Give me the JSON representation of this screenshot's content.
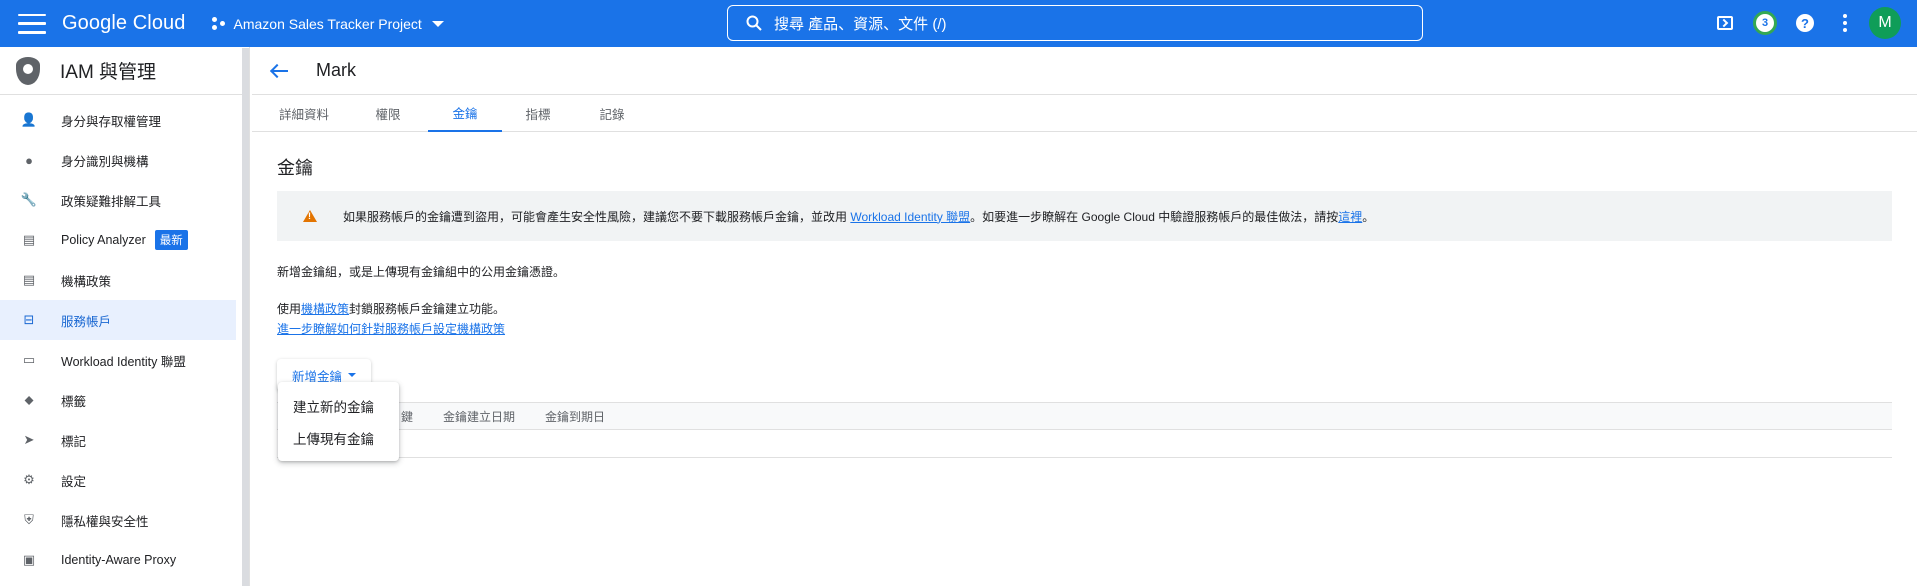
{
  "topbar": {
    "brand": "Google Cloud",
    "project": "Amazon Sales Tracker Project",
    "search_placeholder": "搜尋  產品、資源、文件 (/)",
    "notification_count": "3",
    "help": "?",
    "avatar_initial": "M",
    "colors": {
      "bar": "#1a73e8",
      "avatar": "#0f9d58"
    }
  },
  "sidebar": {
    "title": "IAM 與管理",
    "items": [
      {
        "label": "身分與存取權管理",
        "icon": "person-add-icon"
      },
      {
        "label": "身分識別與機構",
        "icon": "account-circle-icon"
      },
      {
        "label": "政策疑難排解工具",
        "icon": "wrench-icon"
      },
      {
        "label": "Policy Analyzer",
        "icon": "policy-analyzer-icon",
        "badge": "最新"
      },
      {
        "label": "機構政策",
        "icon": "list-alt-icon"
      },
      {
        "label": "服務帳戶",
        "icon": "service-account-icon",
        "active": true
      },
      {
        "label": "Workload Identity 聯盟",
        "icon": "id-card-icon"
      },
      {
        "label": "標籤",
        "icon": "tag-icon"
      },
      {
        "label": "標記",
        "icon": "label-icon"
      },
      {
        "label": "設定",
        "icon": "gear-icon"
      },
      {
        "label": "隱私權與安全性",
        "icon": "shield-icon"
      },
      {
        "label": "Identity-Aware Proxy",
        "icon": "proxy-icon"
      }
    ]
  },
  "main": {
    "title": "Mark",
    "tabs": [
      "詳細資料",
      "權限",
      "金鑰",
      "指標",
      "記錄"
    ],
    "active_tab": "金鑰",
    "section_title": "金鑰",
    "warning": {
      "text_1": "如果服務帳戶的金鑰遭到盜用，可能會產生安全性風險，建議您不要下載服務帳戶金鑰，並改用 ",
      "link_1": "Workload Identity 聯盟",
      "text_2": "。如要進一步瞭解在 Google Cloud 中驗證服務帳戶的最佳做法，請按",
      "link_2": "這裡",
      "text_3": "。"
    },
    "para_1": "新增金鑰組，或是上傳現有金鑰組中的公用金鑰憑證。",
    "para_2_prefix": "使用",
    "para_2_link": "機構政策",
    "para_2_suffix": "封鎖服務帳戶金鑰建立功能。",
    "para_2_link2": "進一步瞭解如何針對服務帳戶設定機構政策",
    "add_key_label": "新增金鑰",
    "table_headers": [
      "鍵",
      "金鑰建立日期",
      "金鑰到期日"
    ],
    "menu_items": [
      "建立新的金鑰",
      "上傳現有金鑰"
    ]
  }
}
